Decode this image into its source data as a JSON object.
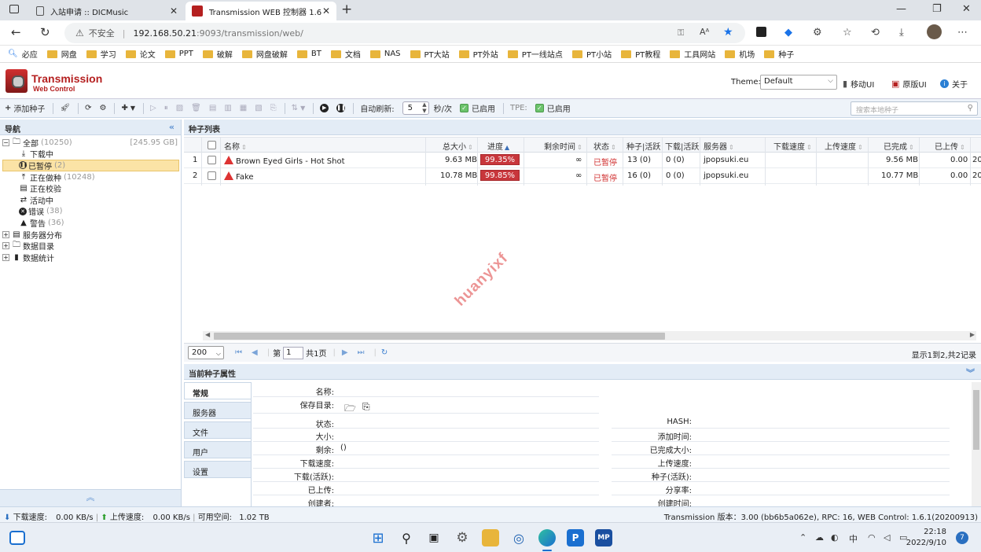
{
  "browser": {
    "tabs": [
      {
        "title": "入站申请 :: DICMusic",
        "active": false
      },
      {
        "title": "Transmission WEB 控制器 1.6.1",
        "active": true
      }
    ],
    "address": {
      "security_label": "不安全",
      "host": "192.168.50.21",
      "rest": ":9093/transmission/web/"
    },
    "bookmarks": [
      "必应",
      "网盘",
      "学习",
      "论文",
      "PPT",
      "破解",
      "网盘破解",
      "BT",
      "文档",
      "NAS",
      "PT大站",
      "PT外站",
      "PT一线站点",
      "PT小站",
      "PT教程",
      "工具网站",
      "机场",
      "种子"
    ]
  },
  "app": {
    "brand_line1": "Transmission",
    "brand_line2": "Web Control",
    "theme_label": "Theme:",
    "theme_value": "Default",
    "links": [
      "移动UI",
      "原版UI",
      "关于"
    ]
  },
  "toolbar": {
    "add_label": "添加种子",
    "auto_refresh_label": "自动刷新:",
    "refresh_interval": "5",
    "refresh_unit": "秒/次",
    "enabled_label": "已启用",
    "tpe_label": "TPE:",
    "tpe_enabled_label": "已启用",
    "search_placeholder": "搜索本地种子"
  },
  "nav": {
    "title": "导航",
    "items": [
      {
        "label": "全部",
        "count": "(10250)",
        "size": "[245.95 GB]",
        "level": 0,
        "icon": "folder-icon"
      },
      {
        "label": "下载中",
        "count": "",
        "level": 1,
        "icon": "download-icon"
      },
      {
        "label": "已暂停",
        "count": "(2)",
        "level": 1,
        "icon": "pause-icon",
        "selected": true
      },
      {
        "label": "正在做种",
        "count": "(10248)",
        "level": 1,
        "icon": "upload-icon"
      },
      {
        "label": "正在校验",
        "count": "",
        "level": 1,
        "icon": "checking-icon"
      },
      {
        "label": "活动中",
        "count": "",
        "level": 1,
        "icon": "activity-icon"
      },
      {
        "label": "错误",
        "count": "(38)",
        "level": 1,
        "icon": "error-icon"
      },
      {
        "label": "警告",
        "count": "(36)",
        "level": 1,
        "icon": "warning-icon"
      },
      {
        "label": "服务器分布",
        "count": "",
        "level": 0,
        "icon": "server-icon"
      },
      {
        "label": "数据目录",
        "count": "",
        "level": 0,
        "icon": "folder-icon"
      },
      {
        "label": "数据统计",
        "count": "",
        "level": 0,
        "icon": "stats-icon"
      }
    ]
  },
  "list": {
    "title": "种子列表",
    "columns": [
      "名称",
      "总大小",
      "进度",
      "剩余时间",
      "状态",
      "种子|活跃",
      "下载|活跃",
      "服务器",
      "下载速度",
      "上传速度",
      "已完成",
      "已上传"
    ],
    "rows": [
      {
        "index": "1",
        "name": "Brown Eyed Girls - Hot Shot",
        "size": "9.63 MB",
        "progress": "99.35%",
        "progress_value": 99.35,
        "eta": "∞",
        "status": "已暂停",
        "seeds": "13 (0)",
        "peers": "0 (0)",
        "tracker": "jpopsuki.eu",
        "down_speed": "",
        "up_speed": "",
        "completed": "9.56 MB",
        "uploaded": "0.00",
        "extra": "20"
      },
      {
        "index": "2",
        "name": "Fake",
        "size": "10.78 MB",
        "progress": "99.85%",
        "progress_value": 99.85,
        "eta": "∞",
        "status": "已暂停",
        "seeds": "16 (0)",
        "peers": "0 (0)",
        "tracker": "jpopsuki.eu",
        "down_speed": "",
        "up_speed": "",
        "completed": "10.77 MB",
        "uploaded": "0.00",
        "extra": "20"
      }
    ],
    "watermark": "huanyixf",
    "pager": {
      "page_size": "200",
      "page_prefix": "第",
      "page_number": "1",
      "page_suffix": "共1页",
      "info": "显示1到2,共2记录"
    }
  },
  "details": {
    "title": "当前种子属性",
    "tabs": [
      "常规",
      "服务器",
      "文件",
      "用户",
      "设置"
    ],
    "left_labels": [
      "名称:",
      "保存目录:",
      "状态:",
      "大小:",
      "剩余:",
      "下载速度:",
      "下载(活跃):",
      "已上传:",
      "创建者:"
    ],
    "remaining_value": "()",
    "right_labels": [
      "HASH:",
      "添加时间:",
      "已完成大小:",
      "上传速度:",
      "种子(活跃):",
      "分享率:",
      "创建时间:"
    ]
  },
  "statusbar": {
    "down_label": "下载速度:",
    "down_value": "0.00 KB/s",
    "up_label": "上传速度:",
    "up_value": "0.00 KB/s",
    "free_label": "可用空间:",
    "free_value": "1.02 TB",
    "version": "Transmission 版本：3.00 (bb6b5a062e), RPC: 16, WEB Control: 1.6.1(20200913)"
  },
  "taskbar": {
    "ime": "中",
    "time": "22:18",
    "date": "2022/9/10",
    "notifications": "7"
  },
  "colors": {
    "progress_fill": "#c8363b",
    "paused_text": "#d03030",
    "panel_header": "#e3ecf6",
    "brand": "#b52020"
  }
}
